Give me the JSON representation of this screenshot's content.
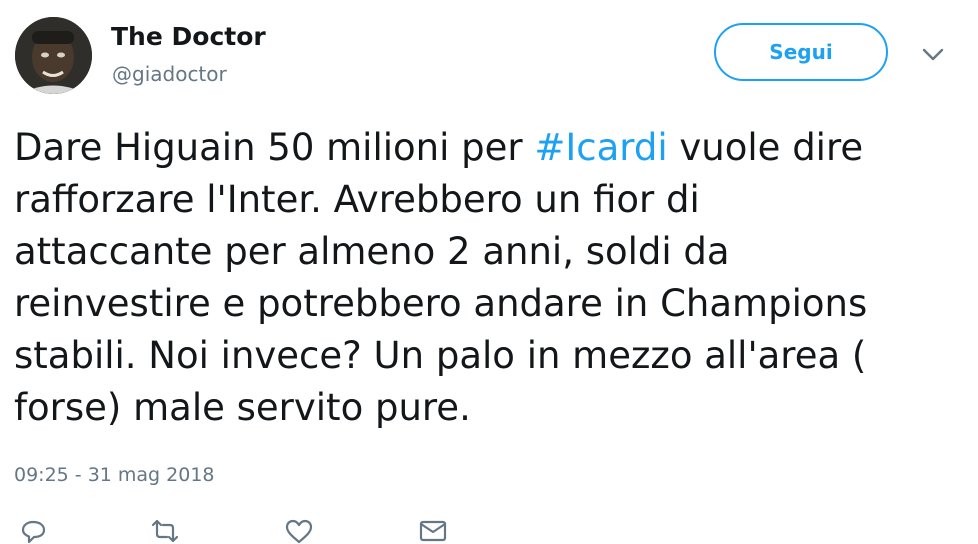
{
  "author": {
    "display_name": "The Doctor",
    "handle": "@giadoctor",
    "avatar_icon": "user-avatar"
  },
  "follow_button": {
    "label": "Segui",
    "color": "#1da1f2"
  },
  "menu_icon": "chevron-down-icon",
  "tweet": {
    "lines": [
      {
        "before": "Dare Higuain 50 milioni per ",
        "hashtag": "#Icardi",
        "after": " vuole dire"
      },
      {
        "text": "rafforzare l'Inter. Avrebbero un fior di"
      },
      {
        "text": "attaccante per almeno 2 anni, soldi da"
      },
      {
        "text": "reinvestire e potrebbero andare in Champions"
      },
      {
        "text": "stabili. Noi invece? Un palo in mezzo all'area ("
      },
      {
        "text": "forse) male servito pure."
      }
    ]
  },
  "timestamp": "09:25 - 31 mag 2018",
  "actions": [
    {
      "name": "reply",
      "icon": "reply-icon"
    },
    {
      "name": "retweet",
      "icon": "retweet-icon"
    },
    {
      "name": "like",
      "icon": "heart-icon"
    },
    {
      "name": "message",
      "icon": "envelope-icon"
    }
  ],
  "colors": {
    "text": "#14171a",
    "secondary": "#657786",
    "link": "#1da1f2"
  }
}
